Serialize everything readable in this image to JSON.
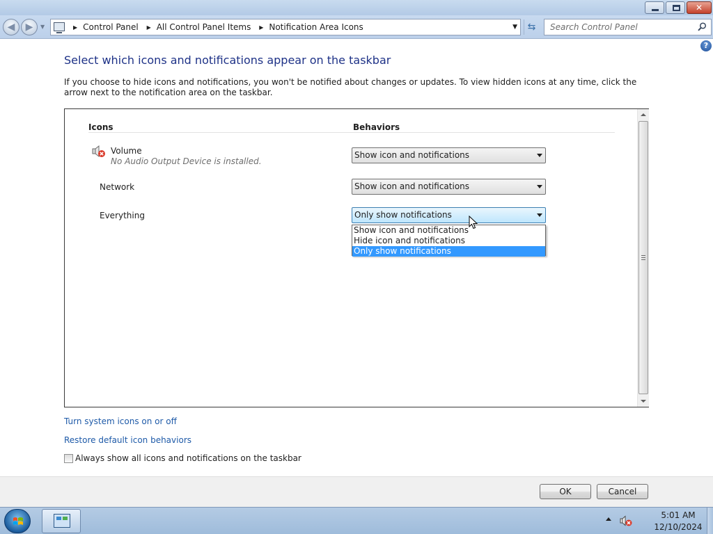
{
  "window": {
    "minimize_icon": "minimize-icon",
    "maximize_icon": "restore-icon",
    "close_icon": "close-icon",
    "close_glyph": "✕"
  },
  "address_bar": {
    "crumbs": [
      "Control Panel",
      "All Control Panel Items",
      "Notification Area Icons"
    ],
    "search_placeholder": "Search Control Panel"
  },
  "help": {
    "glyph": "?"
  },
  "page": {
    "heading": "Select which icons and notifications appear on the taskbar",
    "description": "If you choose to hide icons and notifications, you won't be notified about changes or updates. To view hidden icons at any time, click the arrow next to the notification area on the taskbar."
  },
  "table": {
    "col_icons": "Icons",
    "col_behaviors": "Behaviors",
    "rows": [
      {
        "name": "Volume",
        "subtitle": "No Audio Output Device is installed.",
        "behavior": "Show icon and notifications"
      },
      {
        "name": "Network",
        "behavior": "Show icon and notifications"
      },
      {
        "name": "Everything",
        "behavior": "Only show notifications"
      }
    ],
    "dropdown_options": [
      "Show icon and notifications",
      "Hide icon and notifications",
      "Only show notifications"
    ],
    "dropdown_selected_index": 2
  },
  "links": {
    "system_icons": "Turn system icons on or off",
    "restore_defaults": "Restore default icon behaviors"
  },
  "always_show": {
    "label": "Always show all icons and notifications on the taskbar",
    "checked": false
  },
  "buttons": {
    "ok": "OK",
    "cancel": "Cancel"
  },
  "taskbar": {
    "time": "5:01 AM",
    "date": "12/10/2024"
  },
  "colors": {
    "heading": "#1e3287",
    "link": "#1e5aa8",
    "selected_option": "#3399ff",
    "taskbar": "#b4cbe4"
  }
}
